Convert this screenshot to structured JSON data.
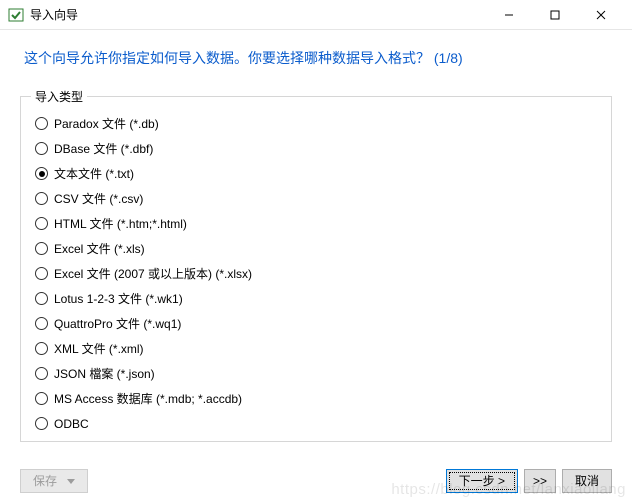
{
  "window": {
    "title": "导入向导"
  },
  "header": {
    "question": "这个向导允许你指定如何导入数据。你要选择哪种数据导入格式？ (1/8)"
  },
  "group": {
    "legend": "导入类型",
    "options": [
      {
        "label": "Paradox 文件 (*.db)",
        "selected": false
      },
      {
        "label": "DBase 文件 (*.dbf)",
        "selected": false
      },
      {
        "label": "文本文件 (*.txt)",
        "selected": true
      },
      {
        "label": "CSV 文件 (*.csv)",
        "selected": false
      },
      {
        "label": "HTML 文件 (*.htm;*.html)",
        "selected": false
      },
      {
        "label": "Excel 文件 (*.xls)",
        "selected": false
      },
      {
        "label": "Excel 文件 (2007 或以上版本) (*.xlsx)",
        "selected": false
      },
      {
        "label": "Lotus 1-2-3 文件 (*.wk1)",
        "selected": false
      },
      {
        "label": "QuattroPro 文件 (*.wq1)",
        "selected": false
      },
      {
        "label": "XML 文件 (*.xml)",
        "selected": false
      },
      {
        "label": "JSON 檔案 (*.json)",
        "selected": false
      },
      {
        "label": "MS Access 数据库 (*.mdb; *.accdb)",
        "selected": false
      },
      {
        "label": "ODBC",
        "selected": false
      }
    ]
  },
  "buttons": {
    "save": "保存",
    "next": "下一步 >",
    "skip": ">>",
    "cancel": "取消"
  },
  "watermark": "https://blog.csdn.net/lanxiaoliang"
}
